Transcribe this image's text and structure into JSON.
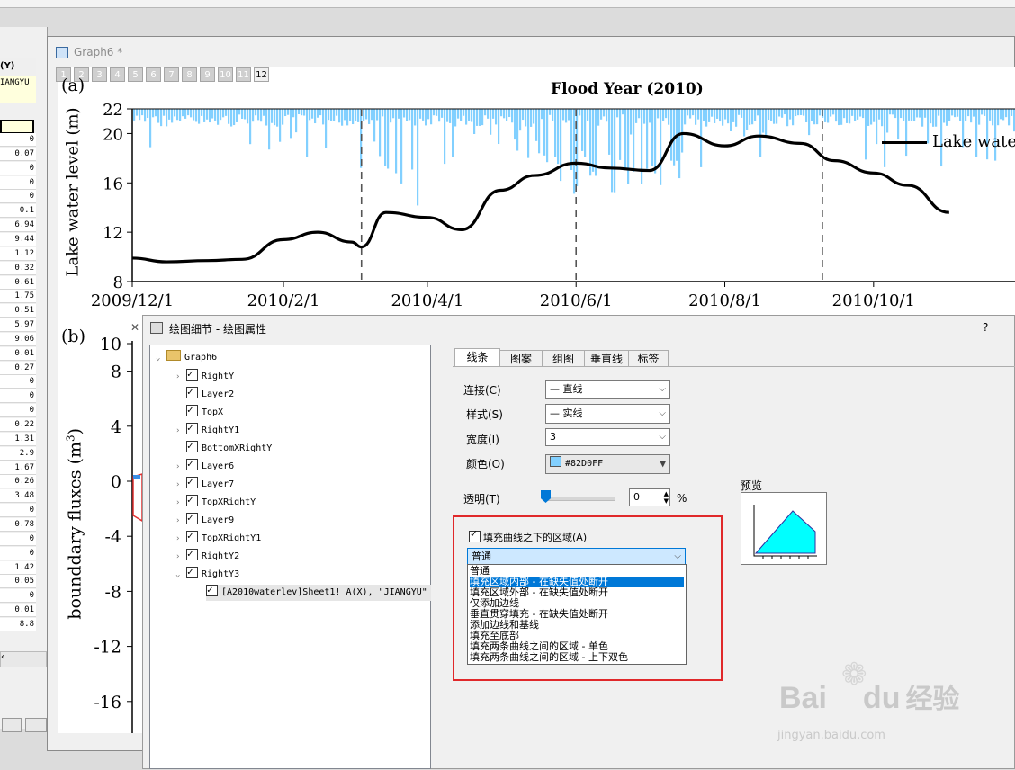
{
  "worksheet": {
    "header": "(Y)",
    "first_cell": "IANGYU",
    "values": [
      "0",
      "0.07",
      "0",
      "0",
      "0",
      "0.1",
      "6.94",
      "9.44",
      "1.12",
      "0.32",
      "0.61",
      "1.75",
      "0.51",
      "5.97",
      "9.06",
      "0.01",
      "0.27",
      "0",
      "0",
      "0",
      "0.22",
      "1.31",
      "2.9",
      "1.67",
      "0.26",
      "3.48",
      "0",
      "0.78",
      "0",
      "0",
      "1.42",
      "0.05",
      "0",
      "0.01",
      "8.8"
    ]
  },
  "graph_window": {
    "title": "Graph6 *",
    "layer_tabs": [
      "1",
      "2",
      "3",
      "4",
      "5",
      "6",
      "7",
      "8",
      "9",
      "10",
      "11",
      "12"
    ],
    "active_tab": "12"
  },
  "chart_data": [
    {
      "type": "area",
      "panel_label": "(a)",
      "title": "Flood Year (2010)",
      "ylabel": "Lake water level (m)",
      "ylim": [
        8,
        22
      ],
      "yticks": [
        "8",
        "12",
        "16",
        "20",
        "22"
      ],
      "xticks": [
        "2009/12/1",
        "2010/2/1",
        "2010/4/1",
        "2010/6/1",
        "2010/8/1",
        "2010/10/1"
      ],
      "legend": "Lake wate",
      "series": [
        {
          "name": "Lake water level",
          "color": "#000000",
          "x": [
            "2009/12/1",
            "2009/12/15",
            "2010/1/1",
            "2010/1/15",
            "2010/2/1",
            "2010/2/15",
            "2010/3/1",
            "2010/3/5",
            "2010/3/15",
            "2010/4/1",
            "2010/4/15",
            "2010/5/1",
            "2010/5/15",
            "2010/6/1",
            "2010/6/15",
            "2010/7/1",
            "2010/7/15",
            "2010/8/1",
            "2010/8/15",
            "2010/9/1",
            "2010/9/15",
            "2010/10/1",
            "2010/10/15",
            "2010/11/1"
          ],
          "values": [
            9.9,
            9.6,
            9.7,
            9.8,
            11.4,
            12.0,
            11.2,
            10.8,
            13.6,
            13.2,
            12.2,
            15.4,
            16.6,
            17.6,
            17.2,
            17.0,
            20.0,
            19.0,
            19.8,
            19.2,
            17.8,
            16.8,
            15.8,
            13.6
          ]
        }
      ],
      "fill": {
        "color": "#82D0FF",
        "description": "boundary flux bars hanging from top"
      },
      "vlines_dashed": [
        "2010/3/5",
        "2010/6/1",
        "2010/9/10"
      ]
    },
    {
      "type": "line",
      "panel_label": "(b)",
      "ylabel": "bounddary fluxes (m3)",
      "yticks": [
        "10",
        "8",
        "4",
        "0",
        "-4",
        "-8",
        "-12",
        "-16"
      ]
    }
  ],
  "dialog": {
    "title": "绘图细节 - 绘图属性",
    "help": "?",
    "tree": {
      "root": "Graph6",
      "items": [
        "RightY",
        "Layer2",
        "TopX",
        "RightY1",
        "BottomXRightY",
        "Layer6",
        "Layer7",
        "TopXRightY",
        "Layer9",
        "TopXRightY1",
        "RightY2",
        "RightY3"
      ],
      "leaf": "[A2010waterlev]Sheet1! A(X), \"JIANGYU\""
    },
    "tabs": [
      "线条",
      "图案",
      "组图",
      "垂直线",
      "标签"
    ],
    "line": {
      "connect_label": "连接(C)",
      "connect_value": "— 直线",
      "style_label": "样式(S)",
      "style_value": "— 实线",
      "width_label": "宽度(I)",
      "width_value": "3",
      "color_label": "颜色(O)",
      "color_value": "#82D0FF",
      "transparency_label": "透明(T)",
      "transparency_value": "0",
      "percent": "%"
    },
    "fill": {
      "checkbox_label": "填充曲线之下的区域(A)",
      "selected": "普通",
      "options": [
        "普通",
        "填充区域内部 - 在缺失值处断开",
        "填充区域外部 - 在缺失值处断开",
        "仅添加边线",
        "垂直贯穿填充 - 在缺失值处断开",
        "添加边线和基线",
        "填充至底部",
        "填充两条曲线之间的区域 - 单色",
        "填充两条曲线之间的区域 - 上下双色"
      ],
      "highlighted_index": 1
    },
    "preview_label": "预览"
  },
  "watermark": {
    "text1": "Bai",
    "text2": "du",
    "text3": "经验",
    "url": "jingyan.baidu.com"
  }
}
